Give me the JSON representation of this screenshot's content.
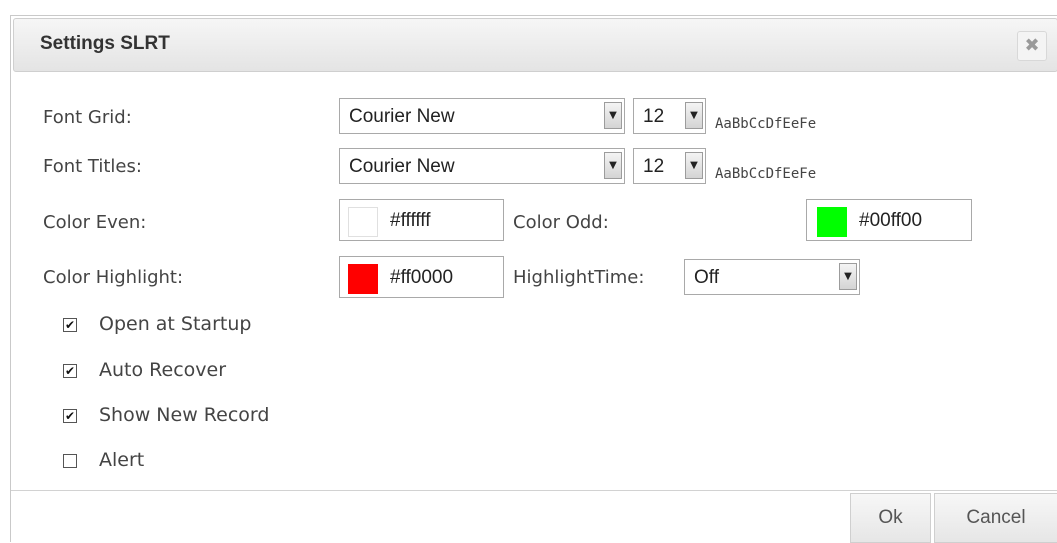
{
  "dialog": {
    "title": "Settings SLRT",
    "close_icon": "close-icon",
    "close_glyph": "✖"
  },
  "font_grid": {
    "label": "Font Grid:",
    "font": "Courier New",
    "size": "12",
    "preview": "AaBbCcDfEeFe"
  },
  "font_titles": {
    "label": "Font Titles:",
    "font": "Courier New",
    "size": "12",
    "preview": "AaBbCcDfEeFe"
  },
  "color_even": {
    "label": "Color Even:",
    "value": "#ffffff",
    "swatch": "#ffffff"
  },
  "color_odd": {
    "label": "Color Odd:",
    "value": "#00ff00",
    "swatch": "#00ff00"
  },
  "color_highlight": {
    "label": "Color Highlight:",
    "value": "#ff0000",
    "swatch": "#ff0000"
  },
  "highlight_time": {
    "label": "HighlightTime:",
    "value": "Off"
  },
  "checkboxes": [
    {
      "label": "Open at Startup",
      "checked": true
    },
    {
      "label": "Auto Recover",
      "checked": true
    },
    {
      "label": "Show New Record",
      "checked": true
    },
    {
      "label": "Alert",
      "checked": false
    }
  ],
  "buttons": {
    "ok": "Ok",
    "cancel": "Cancel"
  },
  "dropdown_arrow_icon": "chevron-down-icon",
  "dropdown_glyph": "▼",
  "check_glyph": "✔"
}
